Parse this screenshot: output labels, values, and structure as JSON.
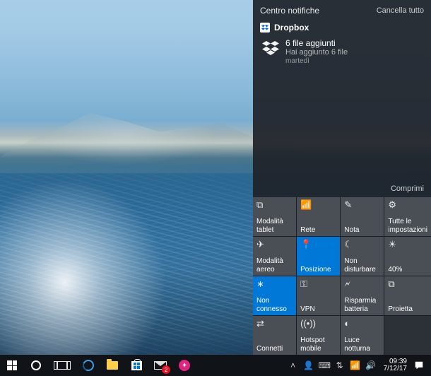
{
  "action_center": {
    "title": "Centro notifiche",
    "clear_all": "Cancella tutto",
    "collapse": "Comprimi",
    "group": {
      "app_name": "Dropbox",
      "item": {
        "title": "6 file aggiunti",
        "subtitle": "Hai aggiunto 6 file",
        "timestamp": "martedì"
      }
    },
    "quick_actions": [
      {
        "id": "tablet-mode",
        "icon": "tablet-icon",
        "label": "Modalità tablet",
        "active": false
      },
      {
        "id": "network",
        "icon": "network-icon",
        "label": "Rete",
        "active": false
      },
      {
        "id": "note",
        "icon": "note-icon",
        "label": "Nota",
        "active": false
      },
      {
        "id": "all-settings",
        "icon": "gear-icon",
        "label": "Tutte le impostazioni",
        "active": false
      },
      {
        "id": "airplane",
        "icon": "airplane-icon",
        "label": "Modalità aereo",
        "active": false
      },
      {
        "id": "location",
        "icon": "location-icon",
        "label": "Posizione",
        "active": true
      },
      {
        "id": "quiet-hours",
        "icon": "moon-icon",
        "label": "Non disturbare",
        "active": false
      },
      {
        "id": "brightness",
        "icon": "sun-icon",
        "label": "40%",
        "active": false
      },
      {
        "id": "bluetooth",
        "icon": "bluetooth-icon",
        "label": "Non connesso",
        "active": true
      },
      {
        "id": "vpn",
        "icon": "vpn-icon",
        "label": "VPN",
        "active": false
      },
      {
        "id": "battery-saver",
        "icon": "battery-icon",
        "label": "Risparmia batteria",
        "active": false
      },
      {
        "id": "project",
        "icon": "project-icon",
        "label": "Proietta",
        "active": false
      },
      {
        "id": "connect",
        "icon": "connect-icon",
        "label": "Connetti",
        "active": false
      },
      {
        "id": "hotspot",
        "icon": "hotspot-icon",
        "label": "Hotspot mobile",
        "active": false
      },
      {
        "id": "night-light",
        "icon": "nightlight-icon",
        "label": "Luce notturna",
        "active": false
      },
      {
        "id": "blank",
        "icon": "",
        "label": "",
        "active": false,
        "blank": true
      }
    ]
  },
  "taskbar": {
    "mail_badge": "2",
    "clock": {
      "time": "09:39",
      "date": "7/12/17"
    }
  },
  "qa_glyphs": {
    "tablet-icon": "⧉",
    "network-icon": "📶",
    "note-icon": "✎",
    "gear-icon": "⚙",
    "airplane-icon": "✈",
    "location-icon": "📍",
    "moon-icon": "☾",
    "sun-icon": "☀",
    "bluetooth-icon": "∗",
    "vpn-icon": "⚿",
    "battery-icon": "🗲",
    "project-icon": "⧉",
    "connect-icon": "⇄",
    "hotspot-icon": "((•))",
    "nightlight-icon": "◐"
  }
}
